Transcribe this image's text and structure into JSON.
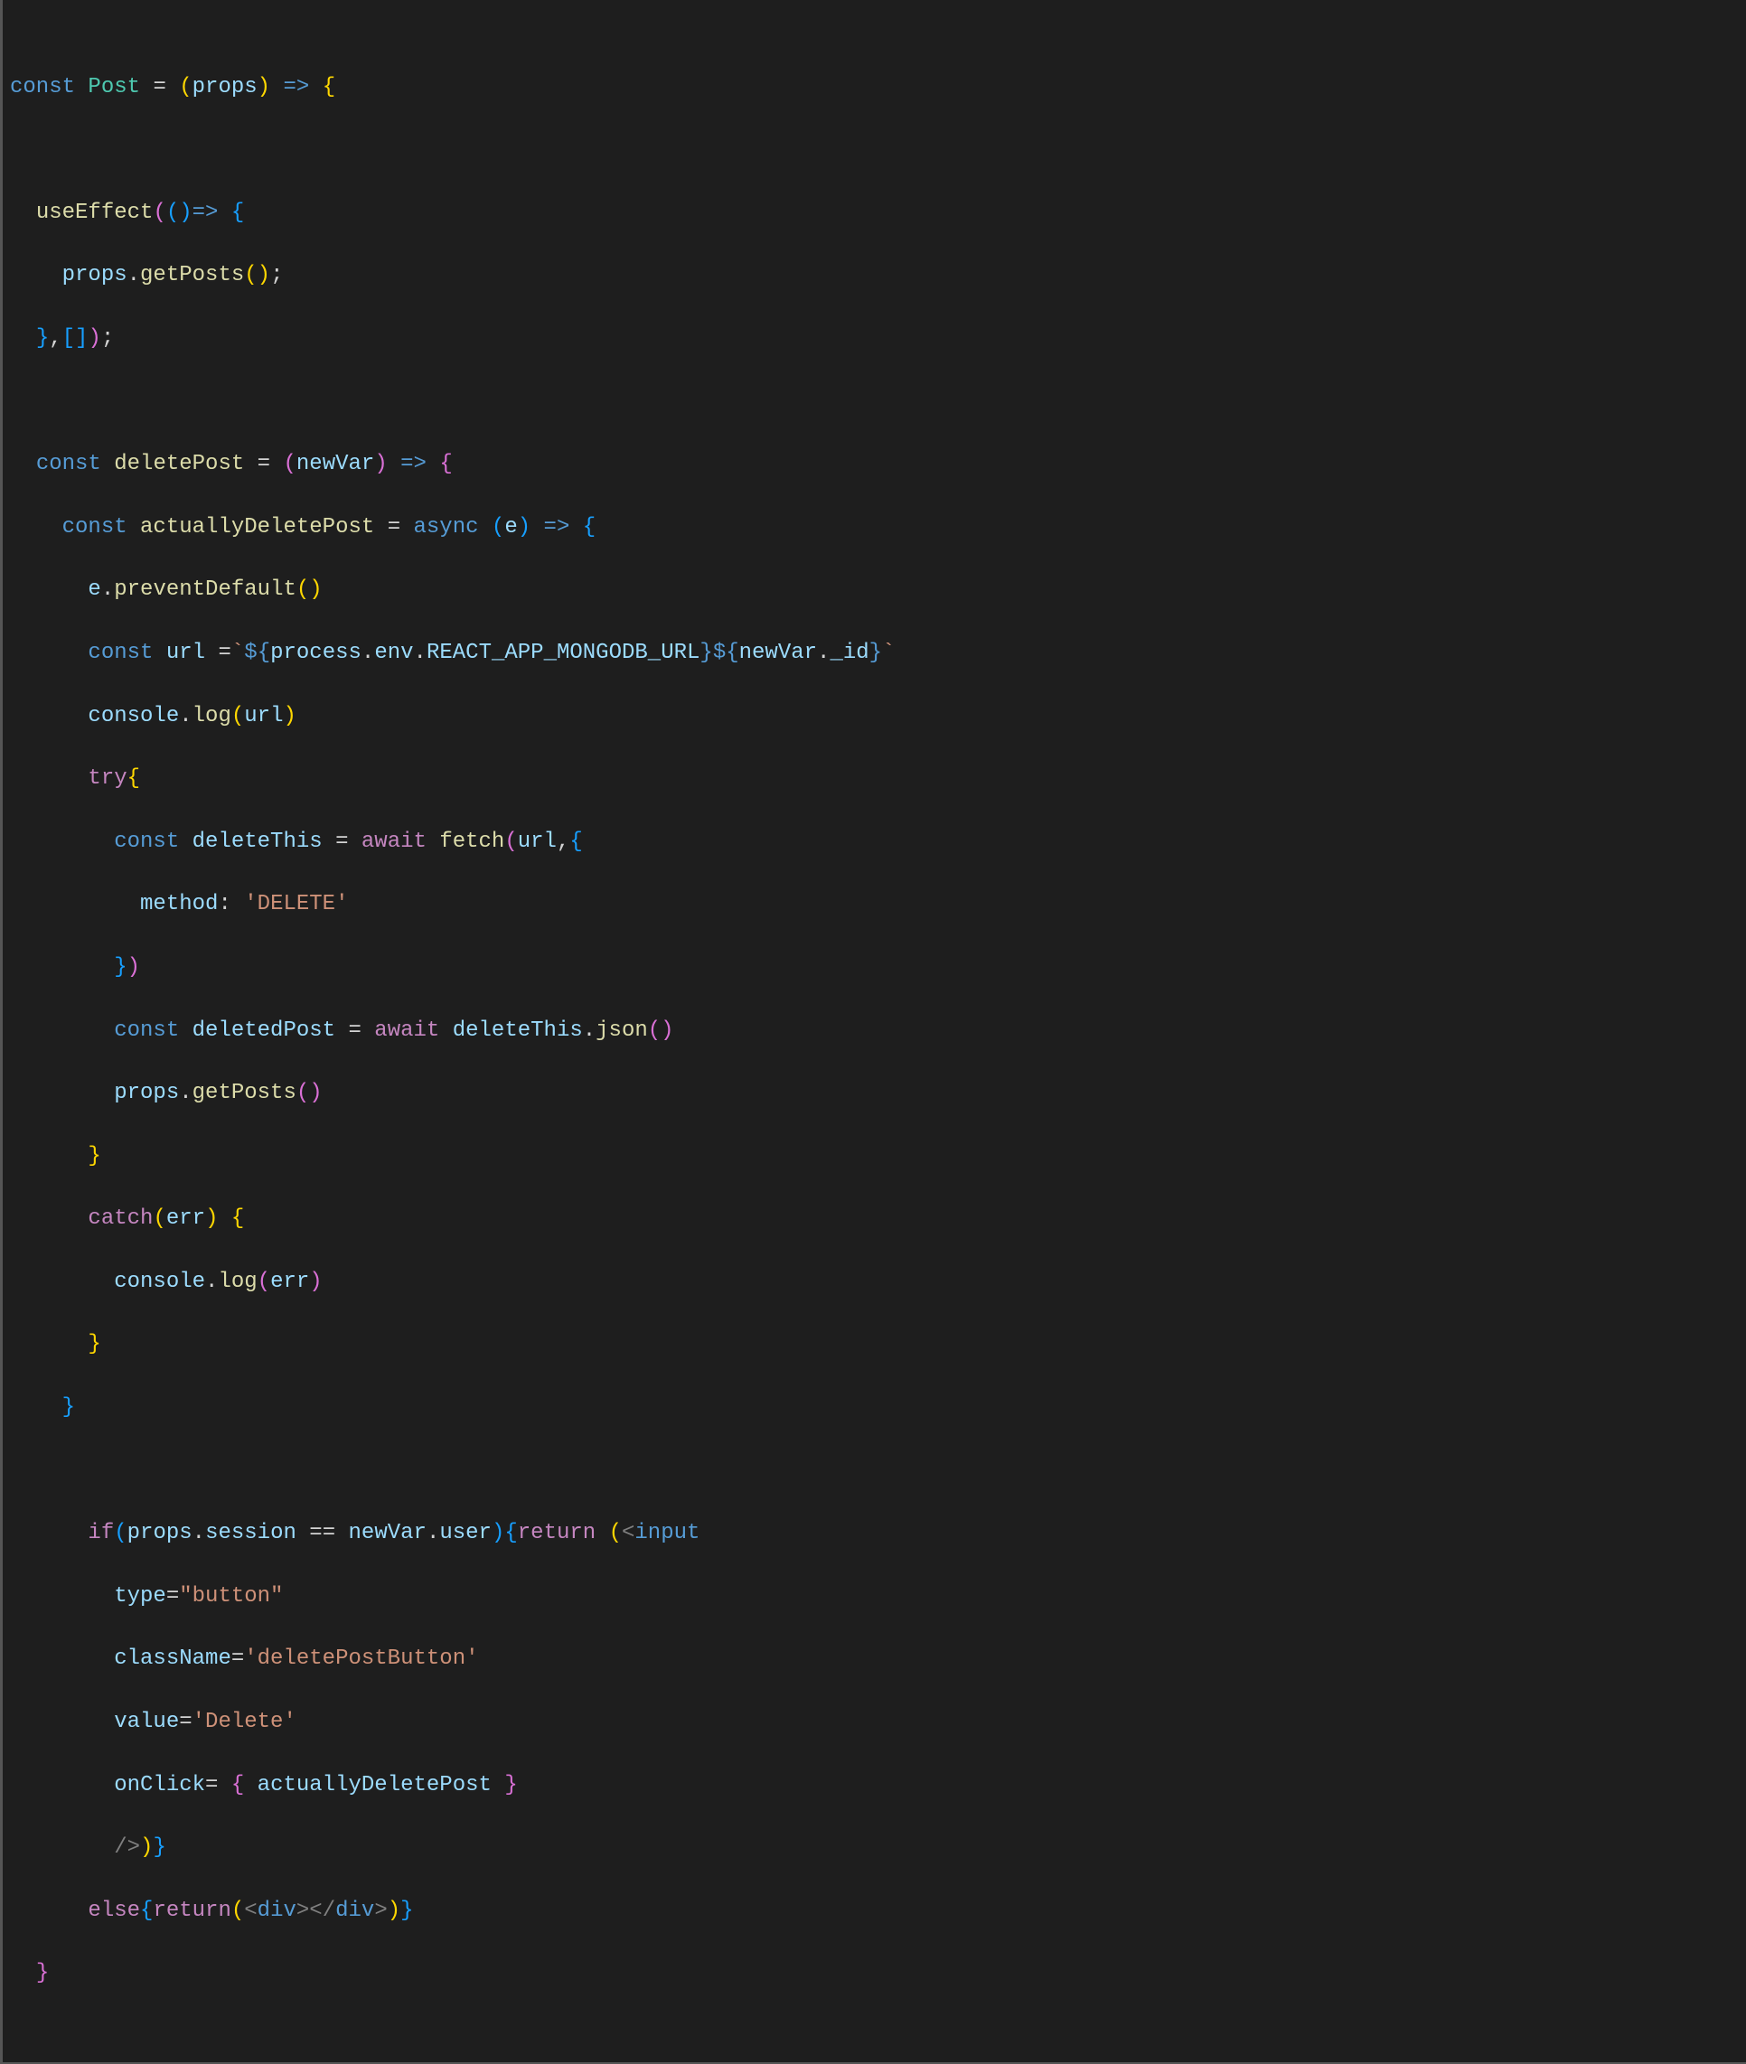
{
  "code": {
    "l1": {
      "const": "const",
      "Post": "Post",
      "eq": "=",
      "lp": "(",
      "props": "props",
      "rp": ")",
      "arrow": "=>",
      "lb": "{"
    },
    "l2": "",
    "l3": {
      "useEffect": "useEffect",
      "lp": "(",
      "lp2": "(",
      "rp2": ")",
      "arrow": "=>",
      "lb": "{"
    },
    "l4": {
      "props": "props",
      "dot": ".",
      "getPosts": "getPosts",
      "lp": "(",
      "rp": ")",
      "sc": ";"
    },
    "l5": {
      "rb": "}",
      "c": ",",
      "lb": "[",
      "rb2": "]",
      "rp": ")",
      "sc": ";"
    },
    "l6": "",
    "l7": {
      "const": "const",
      "deletePost": "deletePost",
      "eq": "=",
      "lp": "(",
      "newVar": "newVar",
      "rp": ")",
      "arrow": "=>",
      "lb": "{"
    },
    "l8": {
      "const": "const",
      "actuallyDeletePost": "actuallyDeletePost",
      "eq": "=",
      "async": "async",
      "lp": "(",
      "e": "e",
      "rp": ")",
      "arrow": "=>",
      "lb": "{"
    },
    "l9": {
      "e": "e",
      "dot": ".",
      "preventDefault": "preventDefault",
      "lp": "(",
      "rp": ")"
    },
    "l10": {
      "const": "const",
      "url": "url",
      "eq": "=",
      "bt": "`",
      "d1": "$",
      "lb1": "{",
      "process": "process",
      "dot1": ".",
      "env": "env",
      "dot2": ".",
      "REACT": "REACT_APP_MONGODB_URL",
      "rb1": "}",
      "d2": "$",
      "lb2": "{",
      "newVar": "newVar",
      "dot3": ".",
      "_id": "_id",
      "rb2": "}",
      "bt2": "`"
    },
    "l11": {
      "console": "console",
      "dot": ".",
      "log": "log",
      "lp": "(",
      "url": "url",
      "rp": ")"
    },
    "l12": {
      "try": "try",
      "lb": "{"
    },
    "l13": {
      "const": "const",
      "deleteThis": "deleteThis",
      "eq": "=",
      "await": "await",
      "fetch": "fetch",
      "lp": "(",
      "url": "url",
      "c": ",",
      "lb": "{"
    },
    "l14": {
      "method": "method",
      "colon": ":",
      "str": "'DELETE'"
    },
    "l15": {
      "rb": "}",
      "rp": ")"
    },
    "l16": {
      "const": "const",
      "deletedPost": "deletedPost",
      "eq": "=",
      "await": "await",
      "deleteThis": "deleteThis",
      "dot": ".",
      "json": "json",
      "lp": "(",
      "rp": ")"
    },
    "l17": {
      "props": "props",
      "dot": ".",
      "getPosts": "getPosts",
      "lp": "(",
      "rp": ")"
    },
    "l18": {
      "rb": "}"
    },
    "l19": {
      "catch": "catch",
      "lp": "(",
      "err": "err",
      "rp": ")",
      "lb": "{"
    },
    "l20": {
      "console": "console",
      "dot": ".",
      "log": "log",
      "lp": "(",
      "err": "err",
      "rp": ")"
    },
    "l21": {
      "rb": "}"
    },
    "l22": {
      "rb": "}"
    },
    "l23": "",
    "l24": {
      "if": "if",
      "lp": "(",
      "props": "props",
      "dot": ".",
      "session": "session",
      "eq": "==",
      "newVar": "newVar",
      "dot2": ".",
      "user": "user",
      "rp": ")",
      "lb": "{",
      "return": "return",
      "lp2": "(",
      "lt": "<",
      "input": "input"
    },
    "l25": {
      "type": "type",
      "eq": "=",
      "str": "\"button\""
    },
    "l26": {
      "className": "className",
      "eq": "=",
      "str": "'deletePostButton'"
    },
    "l27": {
      "value": "value",
      "eq": "=",
      "str": "'Delete'"
    },
    "l28": {
      "onClick": "onClick",
      "eq": "=",
      "lb": "{",
      "actuallyDeletePost": "actuallyDeletePost",
      "rb": "}"
    },
    "l29": {
      "slash": "/>",
      "rp": ")",
      "rb": "}"
    },
    "l30": {
      "else": "else",
      "lb": "{",
      "return": "return",
      "lp": "(",
      "lt": "<",
      "div": "div",
      "gt": ">",
      "lt2": "</",
      "div2": "div",
      "gt2": ">",
      "rp": ")",
      "rb": "}"
    },
    "l31": {
      "rb": "}"
    }
  }
}
